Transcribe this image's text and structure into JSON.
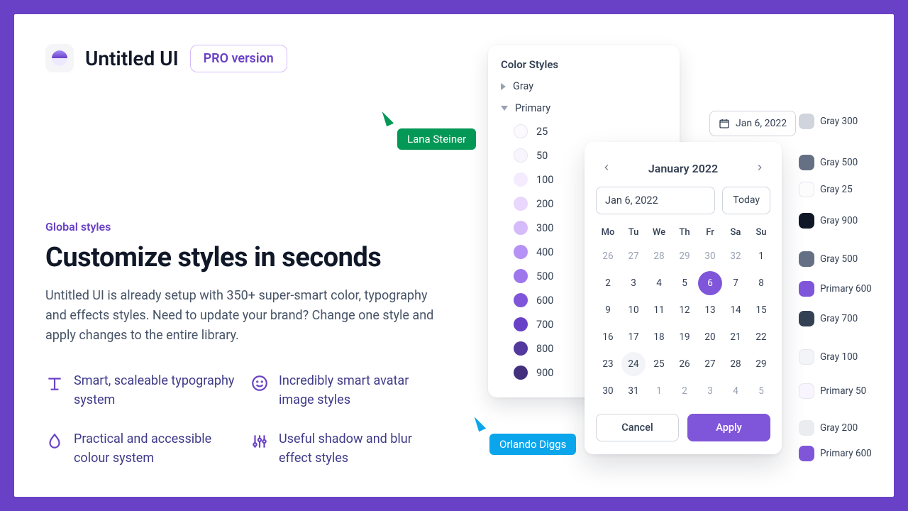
{
  "header": {
    "brand": "Untitled UI",
    "pro_label": "PRO version"
  },
  "content": {
    "eyebrow": "Global styles",
    "title": "Customize styles in seconds",
    "body": "Untitled UI is already setup with 350+ super-smart color, typography and effects styles. Need to update your brand? Change one style and apply changes to the entire library.",
    "features": [
      "Smart, scaleable typography system",
      "Incredibly smart avatar image styles",
      "Practical and accessible colour system",
      "Useful shadow and blur effect styles"
    ]
  },
  "color_panel": {
    "title": "Color Styles",
    "group_gray": "Gray",
    "group_primary": "Primary",
    "swatches": [
      {
        "label": "25",
        "hex": "#FCFAFF"
      },
      {
        "label": "50",
        "hex": "#F9F5FF"
      },
      {
        "label": "100",
        "hex": "#F4EBFF"
      },
      {
        "label": "200",
        "hex": "#E9D7FE"
      },
      {
        "label": "300",
        "hex": "#D6BBFB"
      },
      {
        "label": "400",
        "hex": "#B692F6"
      },
      {
        "label": "500",
        "hex": "#9E77ED"
      },
      {
        "label": "600",
        "hex": "#7F56D9"
      },
      {
        "label": "700",
        "hex": "#6941C6"
      },
      {
        "label": "800",
        "hex": "#53389E"
      },
      {
        "label": "900",
        "hex": "#42307D"
      }
    ]
  },
  "date_button": "Jan 6, 2022",
  "datepicker": {
    "month_label": "January 2022",
    "input_value": "Jan 6, 2022",
    "today_label": "Today",
    "dow": [
      "Mo",
      "Tu",
      "We",
      "Th",
      "Fr",
      "Sa",
      "Su"
    ],
    "grid": [
      [
        "26",
        "27",
        "28",
        "29",
        "30",
        "32",
        "1"
      ],
      [
        "2",
        "3",
        "4",
        "5",
        "6",
        "7",
        "8"
      ],
      [
        "9",
        "10",
        "11",
        "12",
        "13",
        "14",
        "15"
      ],
      [
        "16",
        "17",
        "18",
        "19",
        "20",
        "21",
        "22"
      ],
      [
        "23",
        "24",
        "25",
        "26",
        "27",
        "28",
        "29"
      ],
      [
        "30",
        "31",
        "1",
        "2",
        "3",
        "4",
        "5"
      ]
    ],
    "selected_day": "6",
    "cancel_label": "Cancel",
    "apply_label": "Apply"
  },
  "chips": [
    {
      "label": "Gray 300",
      "hex": "#D0D5DD"
    },
    {
      "label": "Gray 500",
      "hex": "#667085"
    },
    {
      "label": "Gray 25",
      "hex": "#FCFCFD"
    },
    {
      "label": "Gray 900",
      "hex": "#101828"
    },
    {
      "label": "Gray 500",
      "hex": "#667085"
    },
    {
      "label": "Primary 600",
      "hex": "#7F56D9"
    },
    {
      "label": "Gray 700",
      "hex": "#344054"
    },
    {
      "label": "Gray 100",
      "hex": "#F2F4F7"
    },
    {
      "label": "Primary 50",
      "hex": "#F9F5FF"
    },
    {
      "label": "Gray 200",
      "hex": "#EAECF0"
    },
    {
      "label": "Primary 600",
      "hex": "#7F56D9"
    }
  ],
  "cursors": {
    "green": "Lana Steiner",
    "blue": "Orlando Diggs"
  }
}
